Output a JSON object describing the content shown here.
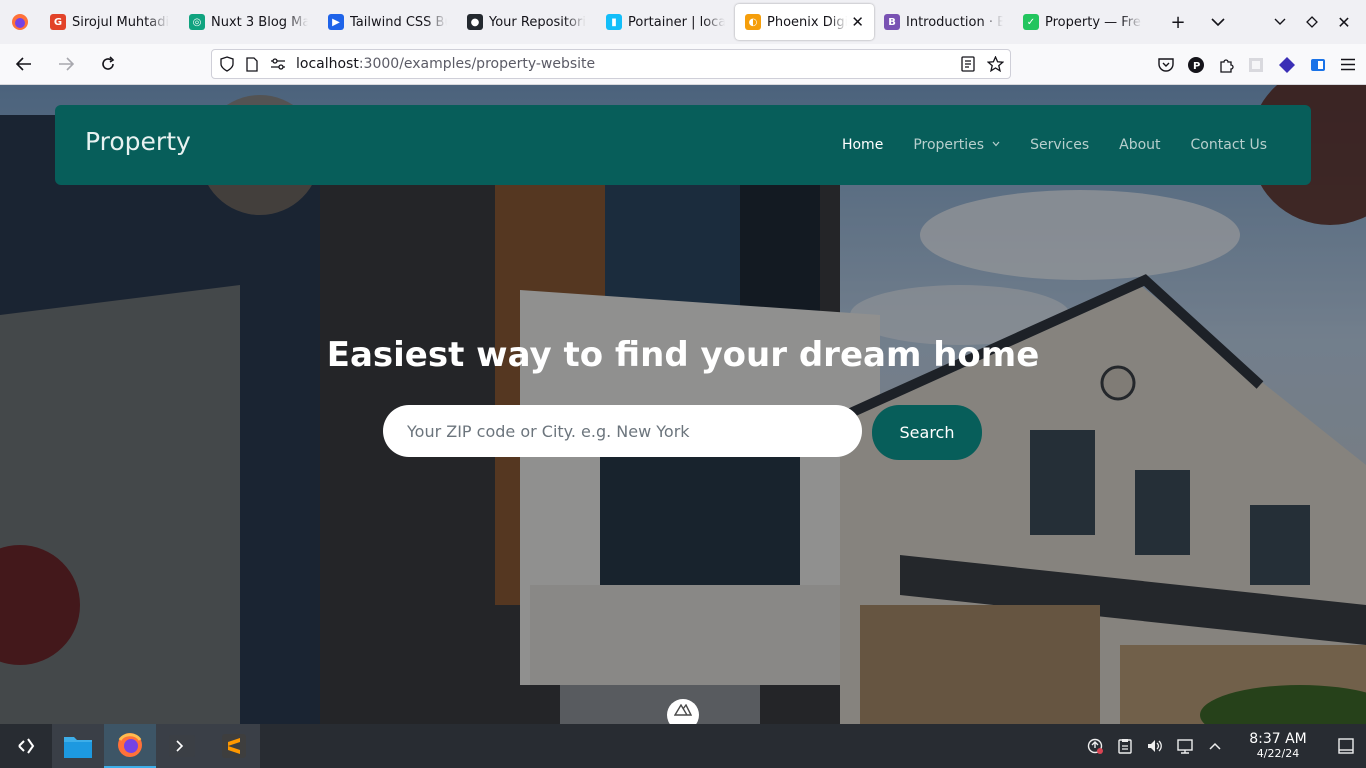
{
  "browser": {
    "tabs": [
      {
        "title": "Sirojul Muhtadi",
        "color": "#e24329",
        "glyph": "G"
      },
      {
        "title": "Nuxt 3 Blog Ma",
        "color": "#10a37f",
        "glyph": "◎"
      },
      {
        "title": "Tailwind CSS Bu",
        "color": "#1e63e9",
        "glyph": "▶"
      },
      {
        "title": "Your Repositori",
        "color": "#24292f",
        "glyph": "●"
      },
      {
        "title": "Portainer | loca",
        "color": "#13bef9",
        "glyph": "▮"
      },
      {
        "title": "Phoenix Digi",
        "color": "#f59e0b",
        "glyph": "◐",
        "active": true
      },
      {
        "title": "Introduction · B",
        "color": "#7952b3",
        "glyph": "B"
      },
      {
        "title": "Property — Fre",
        "color": "#22c55e",
        "glyph": "✓"
      }
    ],
    "close_glyph": "✕",
    "url_host": "localhost",
    "url_path": ":3000/examples/property-website"
  },
  "site": {
    "brand": "Property",
    "menu": [
      {
        "label": "Home",
        "current": true
      },
      {
        "label": "Properties",
        "has_dropdown": true
      },
      {
        "label": "Services"
      },
      {
        "label": "About"
      },
      {
        "label": "Contact Us"
      }
    ],
    "hero_title": "Easiest way to find your dream home",
    "search": {
      "placeholder": "Your ZIP code or City. e.g. New York",
      "button_label": "Search"
    },
    "accent_color": "#075e5a"
  },
  "taskbar": {
    "time": "8:37 AM",
    "date": "4/22/24"
  }
}
